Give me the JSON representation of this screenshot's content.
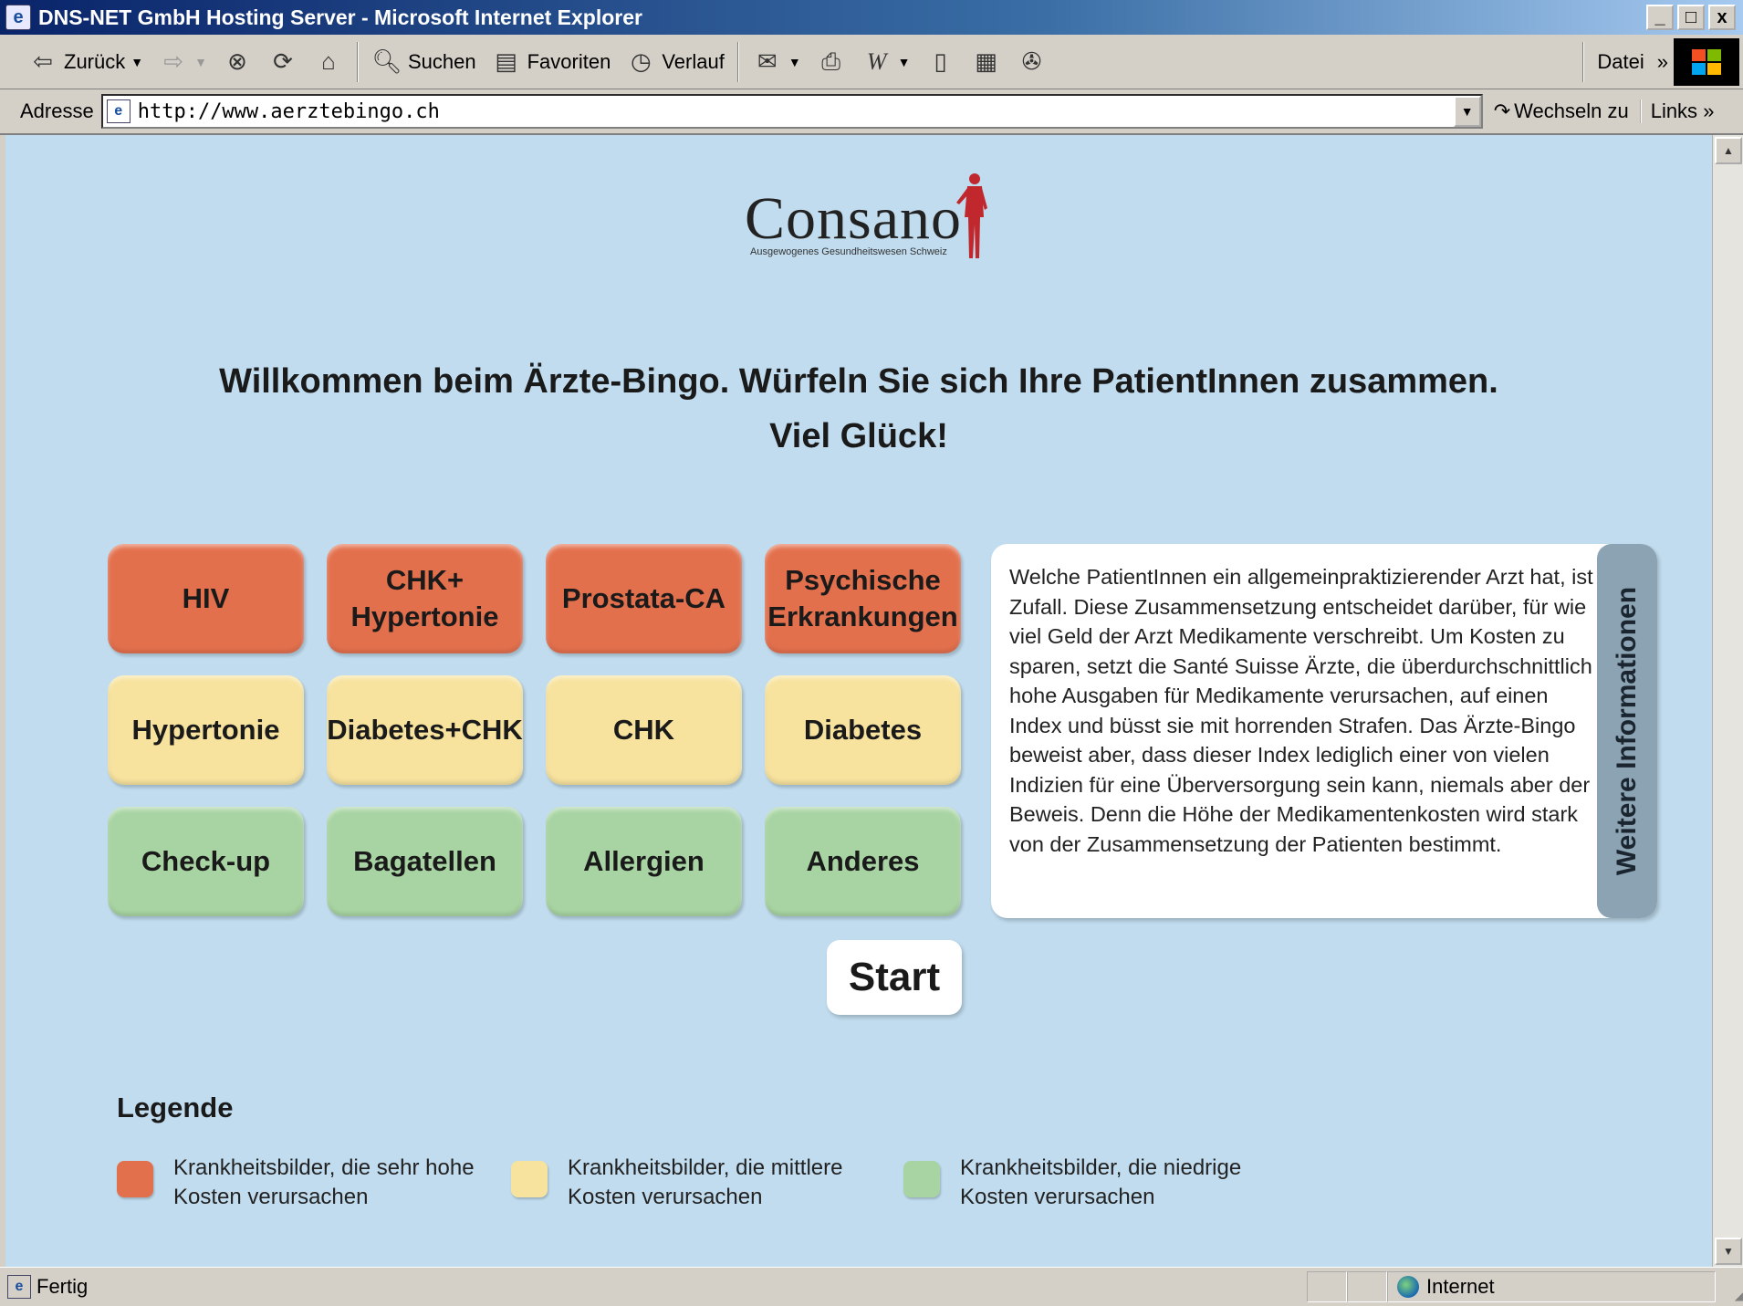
{
  "window": {
    "title": "DNS-NET GmbH Hosting Server - Microsoft Internet Explorer",
    "minimize": "_",
    "maximize": "□",
    "close": "x"
  },
  "toolbar": {
    "back": "Zurück",
    "search": "Suchen",
    "favorites": "Favoriten",
    "history": "Verlauf",
    "menu_file": "Datei",
    "more": "»"
  },
  "address": {
    "label": "Adresse",
    "url": "http://www.aerztebingo.ch",
    "go": "Wechseln zu",
    "links": "Links",
    "links_more": "»"
  },
  "page": {
    "logo": {
      "name": "Consano",
      "tagline": "Ausgewogenes Gesundheitswesen Schweiz"
    },
    "welcome_line1": "Willkommen beim Ärzte-Bingo. Würfeln Sie sich Ihre PatientInnen zusammen.",
    "welcome_line2": "Viel Glück!",
    "tiles": [
      {
        "label": "HIV",
        "level": "high"
      },
      {
        "label": "CHK+\nHypertonie",
        "level": "high"
      },
      {
        "label": "Prostata-CA",
        "level": "high"
      },
      {
        "label": "Psychische\nErkrankungen",
        "level": "high"
      },
      {
        "label": "Hypertonie",
        "level": "mid"
      },
      {
        "label": "Diabetes+CHK",
        "level": "mid"
      },
      {
        "label": "CHK",
        "level": "mid"
      },
      {
        "label": "Diabetes",
        "level": "mid"
      },
      {
        "label": "Check-up",
        "level": "low"
      },
      {
        "label": "Bagatellen",
        "level": "low"
      },
      {
        "label": "Allergien",
        "level": "low"
      },
      {
        "label": "Anderes",
        "level": "low"
      }
    ],
    "info_text": "Welche PatientInnen ein allgemeinpraktizierender Arzt hat, ist Zufall. Diese Zusammensetzung entscheidet darüber, für wie viel Geld der Arzt Medikamente verschreibt. Um Kosten zu sparen, setzt die Santé Suisse Ärzte, die überdurchschnittlich hohe Ausgaben für Medikamente verursachen, auf einen Index und büsst sie mit horrenden Strafen. Das Ärzte-Bingo beweist aber, dass dieser Index lediglich einer von vielen Indizien für eine Überversorgung sein kann, niemals aber der Beweis. Denn die Höhe der Medikamentenkosten wird stark von der Zusammensetzung der Patienten bestimmt.",
    "info_tab": "Weitere Informationen",
    "start": "Start",
    "legend": {
      "title": "Legende",
      "items": [
        {
          "text": "Krankheitsbilder, die sehr hohe\nKosten verursachen",
          "color": "#e3704d"
        },
        {
          "text": "Krankheitsbilder, die mittlere\nKosten verursachen",
          "color": "#f7e39e"
        },
        {
          "text": "Krankheitsbilder, die niedrige\nKosten verursachen",
          "color": "#a8d4a3"
        }
      ]
    }
  },
  "status": {
    "text": "Fertig",
    "zone": "Internet"
  },
  "colors": {
    "page_bg": "#c0dcee",
    "high": "#e3704d",
    "mid": "#f7e39e",
    "low": "#a8d4a3",
    "info_tab": "#8ba3b2"
  }
}
